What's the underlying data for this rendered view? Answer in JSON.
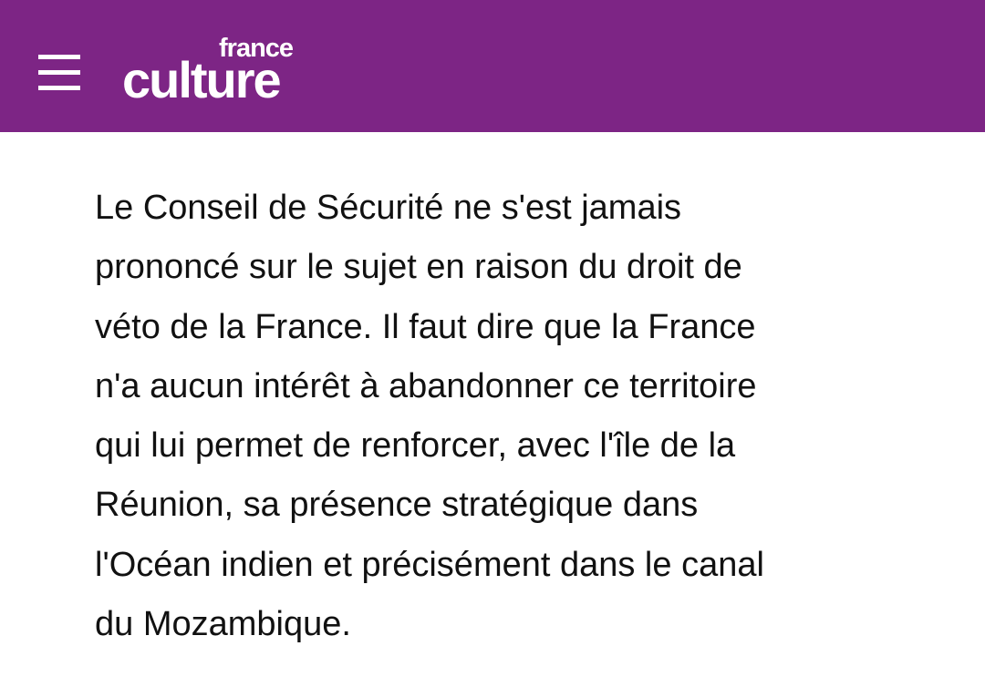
{
  "header": {
    "brand_top": "france",
    "brand_bottom": "culture",
    "color": "#7d2585",
    "menu_icon": "hamburger-menu-icon"
  },
  "article": {
    "lines": [
      "Le Conseil de Sécurité ne s'est jamais",
      "prononcé sur le sujet en raison du droit de",
      "véto de la France. Il faut dire que la France",
      "n'a aucun intérêt à abandonner ce territoire",
      "qui lui permet de renforcer, avec l'île de la",
      "Réunion, sa présence stratégique dans",
      "l'Océan indien et précisément dans le canal",
      "du Mozambique."
    ]
  }
}
